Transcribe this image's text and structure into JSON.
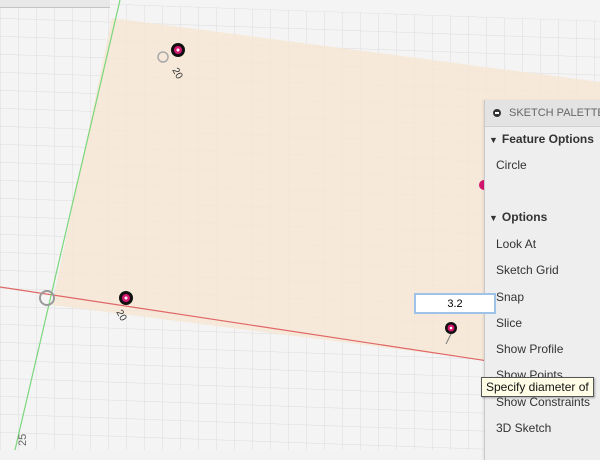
{
  "palette": {
    "title": "SKETCH PALETTE",
    "sections": [
      {
        "label": "Feature Options",
        "items": [
          "Circle"
        ]
      },
      {
        "label": "Options",
        "items": [
          "Look At",
          "Sketch Grid",
          "Snap",
          "Slice",
          "Show Profile",
          "Show Points",
          "Show Constraints",
          "3D Sketch"
        ]
      }
    ]
  },
  "dimension_input": {
    "value": "3.2"
  },
  "tooltip": {
    "text": "Specify diameter of"
  },
  "dimension_labels": {
    "d1": "20",
    "d2": "20"
  },
  "axis": {
    "ruler_label": "25"
  },
  "colors": {
    "sketch_fill": "#f6e6d3",
    "x_axis": "#e06666",
    "y_axis": "#7bd77b",
    "circle_accent": "#d4166f"
  }
}
